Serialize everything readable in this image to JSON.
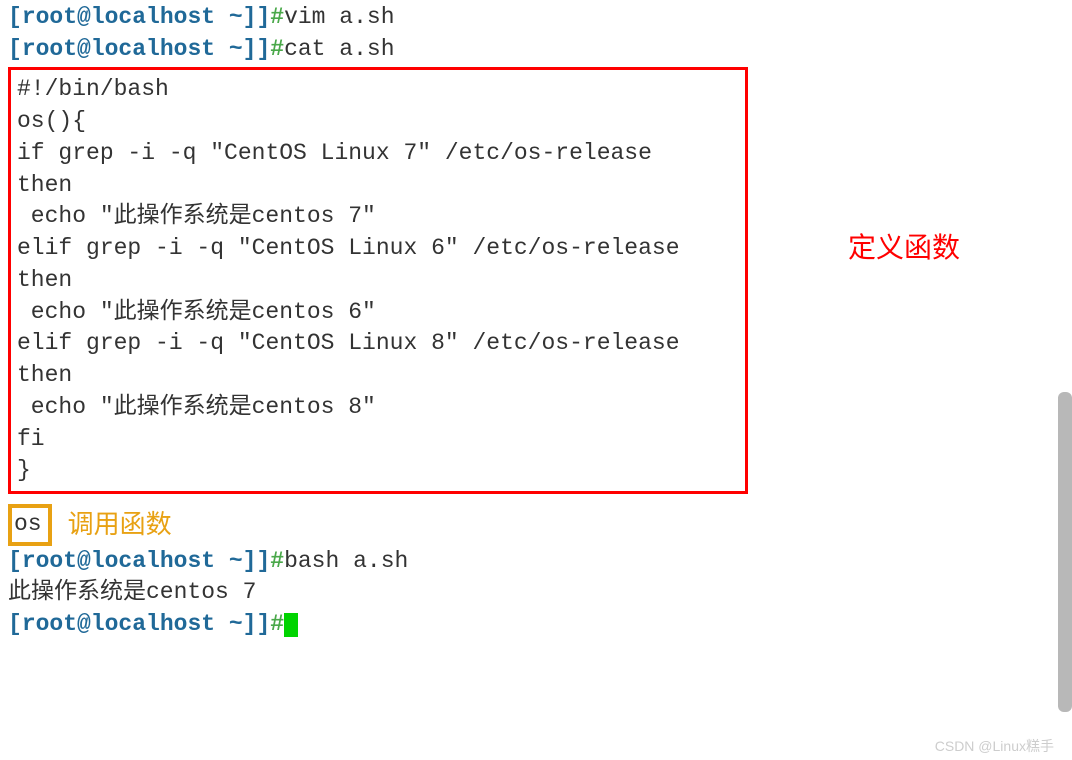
{
  "prompt": {
    "open": "[",
    "user": "root@localhost ~]",
    "close": "]",
    "hash": "#"
  },
  "commands": {
    "vim": "vim a.sh",
    "cat": "cat a.sh",
    "bash": "bash a.sh"
  },
  "script": {
    "l1": "#!/bin/bash",
    "l2": "",
    "l3": "os(){",
    "l4": "if grep -i -q \"CentOS Linux 7\" /etc/os-release",
    "l5": "then",
    "l6": " echo \"此操作系统是centos 7\"",
    "l7": "",
    "l8": "",
    "l9": "elif grep -i -q \"CentOS Linux 6\" /etc/os-release",
    "l10": "then",
    "l11": " echo \"此操作系统是centos 6\"",
    "l12": "",
    "l13": "elif grep -i -q \"CentOS Linux 8\" /etc/os-release",
    "l14": "then",
    "l15": " echo \"此操作系统是centos 8\"",
    "l16": "fi",
    "l17": "}"
  },
  "call": "os ",
  "output": "此操作系统是centos 7",
  "annotations": {
    "define": "定义函数",
    "call": "调用函数"
  },
  "watermark": "CSDN @Linux糕手"
}
